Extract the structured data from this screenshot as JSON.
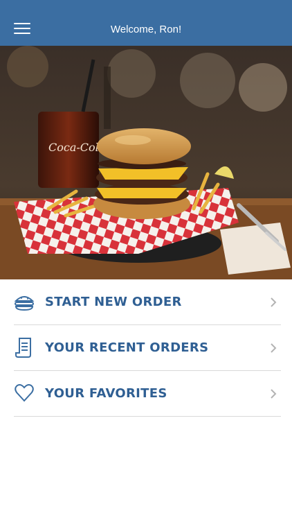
{
  "header": {
    "title": "Welcome, Ron!",
    "menu_icon": "hamburger-menu-icon"
  },
  "hero": {
    "image": "burger-basket-photo",
    "can_label": "Coca-Cola"
  },
  "menu": {
    "items": [
      {
        "label": "START NEW ORDER",
        "icon": "burger-icon"
      },
      {
        "label": "YOUR RECENT ORDERS",
        "icon": "receipt-icon"
      },
      {
        "label": "YOUR FAVORITES",
        "icon": "heart-icon"
      }
    ]
  },
  "colors": {
    "header_bg": "#3b6ea2",
    "accent": "#2f5f93",
    "divider": "#d9d9d9"
  }
}
